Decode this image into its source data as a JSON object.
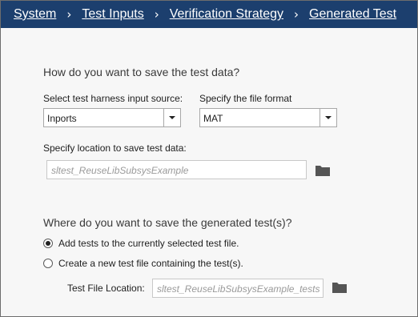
{
  "breadcrumb": {
    "items": [
      "System",
      "Test Inputs",
      "Verification Strategy",
      "Generated Test"
    ],
    "separator": "›"
  },
  "save_data": {
    "heading": "How do you want to save the test data?",
    "harness_label": "Select test harness input source:",
    "harness_value": "Inports",
    "format_label": "Specify the file format",
    "format_value": "MAT",
    "location_label": "Specify location to save test data:",
    "location_placeholder": "sltest_ReuseLibSubsysExample"
  },
  "save_tests": {
    "heading": "Where do you want to save the generated test(s)?",
    "option_add": "Add tests to the currently selected test file.",
    "option_new": "Create a new test file containing the test(s).",
    "selected_option": "option_add",
    "file_location_label": "Test File Location:",
    "file_location_placeholder": "sltest_ReuseLibSubsysExample_tests"
  },
  "colors": {
    "header_bg": "#1c3f6e",
    "panel_bg": "#f7f7f7",
    "folder_icon": "#555555"
  }
}
